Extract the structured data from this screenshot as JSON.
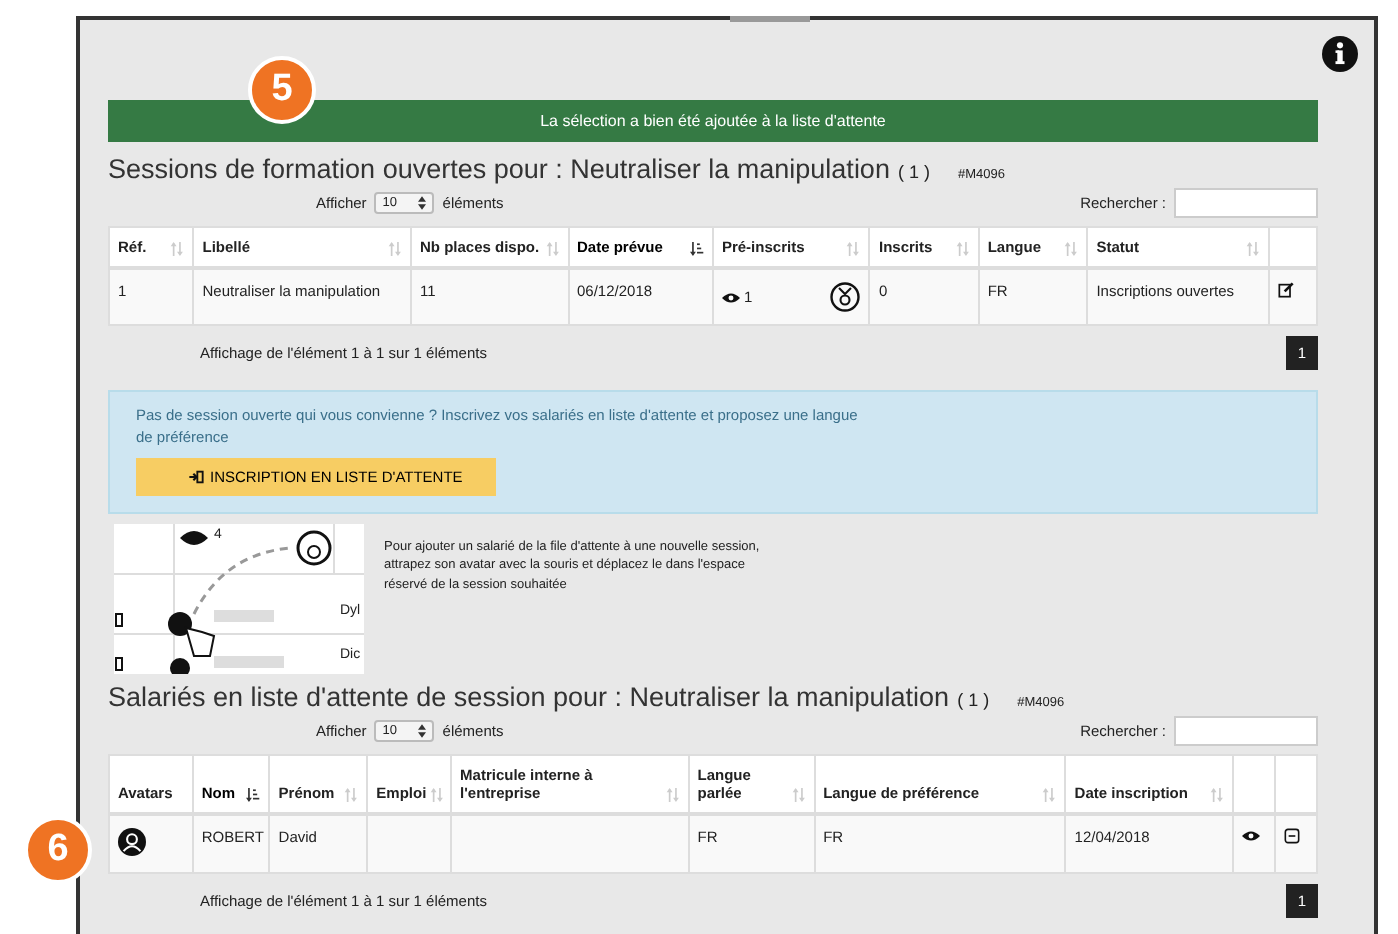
{
  "callouts": [
    "5",
    "6"
  ],
  "alert": {
    "text": "La sélection a bien été ajoutée à la liste d'attente"
  },
  "sessions": {
    "title": "Sessions de formation ouvertes pour : Neutraliser la manipulation",
    "count": "( 1 )",
    "code": "#M4096",
    "length": {
      "before": "Afficher",
      "value": "10",
      "after": "éléments"
    },
    "search": {
      "label": "Rechercher :"
    },
    "columns": [
      {
        "label": "Réf.",
        "sortable": true,
        "sorted": false
      },
      {
        "label": "Libellé",
        "sortable": true,
        "sorted": false
      },
      {
        "label": "Nb places dispo.",
        "sortable": true,
        "sorted": false
      },
      {
        "label": "Date prévue",
        "sortable": true,
        "sorted": true
      },
      {
        "label": "Pré-inscrits",
        "sortable": true,
        "sorted": false
      },
      {
        "label": "Inscrits",
        "sortable": true,
        "sorted": false
      },
      {
        "label": "Langue",
        "sortable": true,
        "sorted": false
      },
      {
        "label": "Statut",
        "sortable": true,
        "sorted": false
      }
    ],
    "rows": [
      {
        "ref": "1",
        "libelle": "Neutraliser la manipulation",
        "places": "11",
        "date": "06/12/2018",
        "preinscrits": "1",
        "inscrits": "0",
        "langue": "FR",
        "statut": "Inscriptions ouvertes"
      }
    ],
    "info": "Affichage de l'élément 1 à 1 sur 1 éléments",
    "pages": [
      {
        "label": "1",
        "selected": true
      }
    ]
  },
  "notice": {
    "text": "Pas de session ouverte qui vous convienne ? Inscrivez vos salariés en liste d'attente et proposez une langue de préférence",
    "button": "INSCRIPTION EN LISTE D'ATTENTE"
  },
  "illustration": {
    "count": "4",
    "labels": [
      "Dyl",
      "Dic"
    ]
  },
  "hint": "Pour ajouter un salarié de la file d'attente à une nouvelle session, attrapez son avatar avec la souris et déplacez le dans l'espace réservé de la session souhaitée",
  "waiting": {
    "title": "Salariés en liste d'attente de session pour : Neutraliser la manipulation",
    "count": "( 1 )",
    "code": "#M4096",
    "length": {
      "before": "Afficher",
      "value": "10",
      "after": "éléments"
    },
    "search": {
      "label": "Rechercher :"
    },
    "columns": [
      {
        "label": "Avatars",
        "sortable": false,
        "sorted": false
      },
      {
        "label": "Nom",
        "sortable": true,
        "sorted": true
      },
      {
        "label": "Prénom",
        "sortable": true,
        "sorted": false
      },
      {
        "label": "Emploi",
        "sortable": true,
        "sorted": false
      },
      {
        "label": "Matricule interne à l'entreprise",
        "sortable": true,
        "sorted": false
      },
      {
        "label": "Langue parlée",
        "sortable": true,
        "sorted": false
      },
      {
        "label": "Langue de préférence",
        "sortable": true,
        "sorted": false
      },
      {
        "label": "Date inscription",
        "sortable": true,
        "sorted": false
      }
    ],
    "rows": [
      {
        "nom": "ROBERT",
        "prenom": "David",
        "parlee": "FR",
        "preference": "FR",
        "date": "12/04/2018"
      }
    ],
    "info": "Affichage de l'élément 1 à 1 sur 1 éléments",
    "pages": [
      {
        "label": "1",
        "selected": true
      }
    ]
  }
}
